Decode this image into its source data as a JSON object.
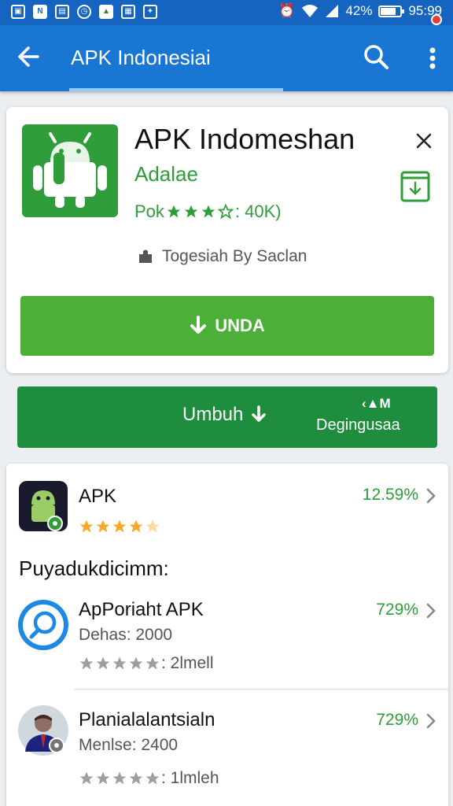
{
  "status_bar": {
    "battery_text": "42%",
    "time": "95:99",
    "notification_icons": [
      "image-icon",
      "n-icon",
      "calendar-icon",
      "alarm-icon",
      "play-store-icon",
      "photo-icon",
      "gift-icon"
    ]
  },
  "app_bar": {
    "title": "APK Indonesiai",
    "icons": [
      "back-arrow-icon",
      "search-icon",
      "more-vert-icon"
    ],
    "accent": "#1976d2"
  },
  "app_card": {
    "app_name": "APK Indomeshan",
    "developer": "Adalae",
    "rating_prefix": "Pok",
    "stars_filled": 3,
    "rating_count": ": 40K)",
    "tagline": "Togesiah By Saclan",
    "install_label": "UNDA",
    "brand_color": "#2e9d3a",
    "button_color": "#4caf37"
  },
  "banner": {
    "left_label": "Umbuh",
    "right_top": "‹▲M",
    "right_bottom": "Degingusaa",
    "color": "#1e8e3e"
  },
  "list": {
    "featured": {
      "title": "APK",
      "percent": "12.59%",
      "stars": 4.5
    },
    "section_label": "Puyadukdicimm:",
    "items": [
      {
        "title": "ApPoriaht APK",
        "subtitle": "Dehas: 2000",
        "rating_text": ": 2lmell",
        "percent": "729%"
      },
      {
        "title": "Planialalantsialn",
        "subtitle": "Menlse: 2400",
        "rating_text": ": 1lmleh",
        "percent": "729%"
      }
    ]
  }
}
